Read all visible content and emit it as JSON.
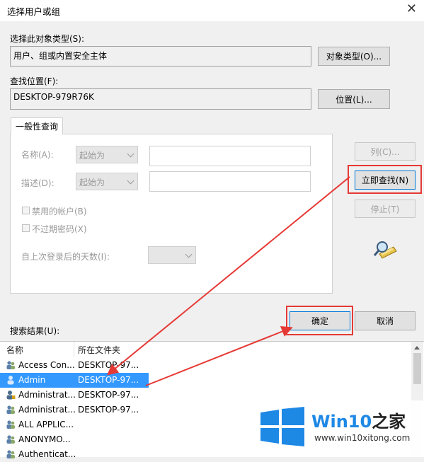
{
  "window": {
    "title": "选择用户或组",
    "close_glyph": "✕"
  },
  "object_type": {
    "label": "选择此对象类型(S):",
    "value": "用户、组或内置安全主体",
    "button": "对象类型(O)..."
  },
  "location": {
    "label": "查找位置(F):",
    "value": "DESKTOP-979R76K",
    "button": "位置(L)..."
  },
  "tab": {
    "label": "一般性查询"
  },
  "query": {
    "name_label": "名称(A):",
    "name_mode": "起始为",
    "desc_label": "描述(D):",
    "desc_mode": "起始为",
    "disabled_accounts": "禁用的帐户(B)",
    "no_expire_pwd": "不过期密码(X)",
    "days_label": "自上次登录后的天数(I):"
  },
  "side_buttons": {
    "columns": "列(C)...",
    "find_now": "立即查找(N)",
    "stop": "停止(T)"
  },
  "dialog_buttons": {
    "ok": "确定",
    "cancel": "取消"
  },
  "results": {
    "label": "搜索结果(U):",
    "columns": [
      "名称",
      "所在文件夹"
    ],
    "rows": [
      {
        "name": "Access Con...",
        "folder": "DESKTOP-97...",
        "icon": "group-icon"
      },
      {
        "name": "Admin",
        "folder": "DESKTOP-97...",
        "icon": "user-icon",
        "selected": true
      },
      {
        "name": "Administrat...",
        "folder": "DESKTOP-97...",
        "icon": "user-icon"
      },
      {
        "name": "Administrat...",
        "folder": "DESKTOP-97...",
        "icon": "group-icon"
      },
      {
        "name": "ALL APPLIC...",
        "folder": "",
        "icon": "group-icon"
      },
      {
        "name": "ANONYMO...",
        "folder": "",
        "icon": "group-icon"
      },
      {
        "name": "Authenticat...",
        "folder": "",
        "icon": "group-icon"
      }
    ]
  },
  "watermark": {
    "brand": "Win10",
    "brand2": "之家",
    "url": "www.win10xitong.com"
  },
  "colors": {
    "highlight": "#e53935",
    "selection": "#3399ff",
    "logo_blue": "#1e88e5"
  }
}
